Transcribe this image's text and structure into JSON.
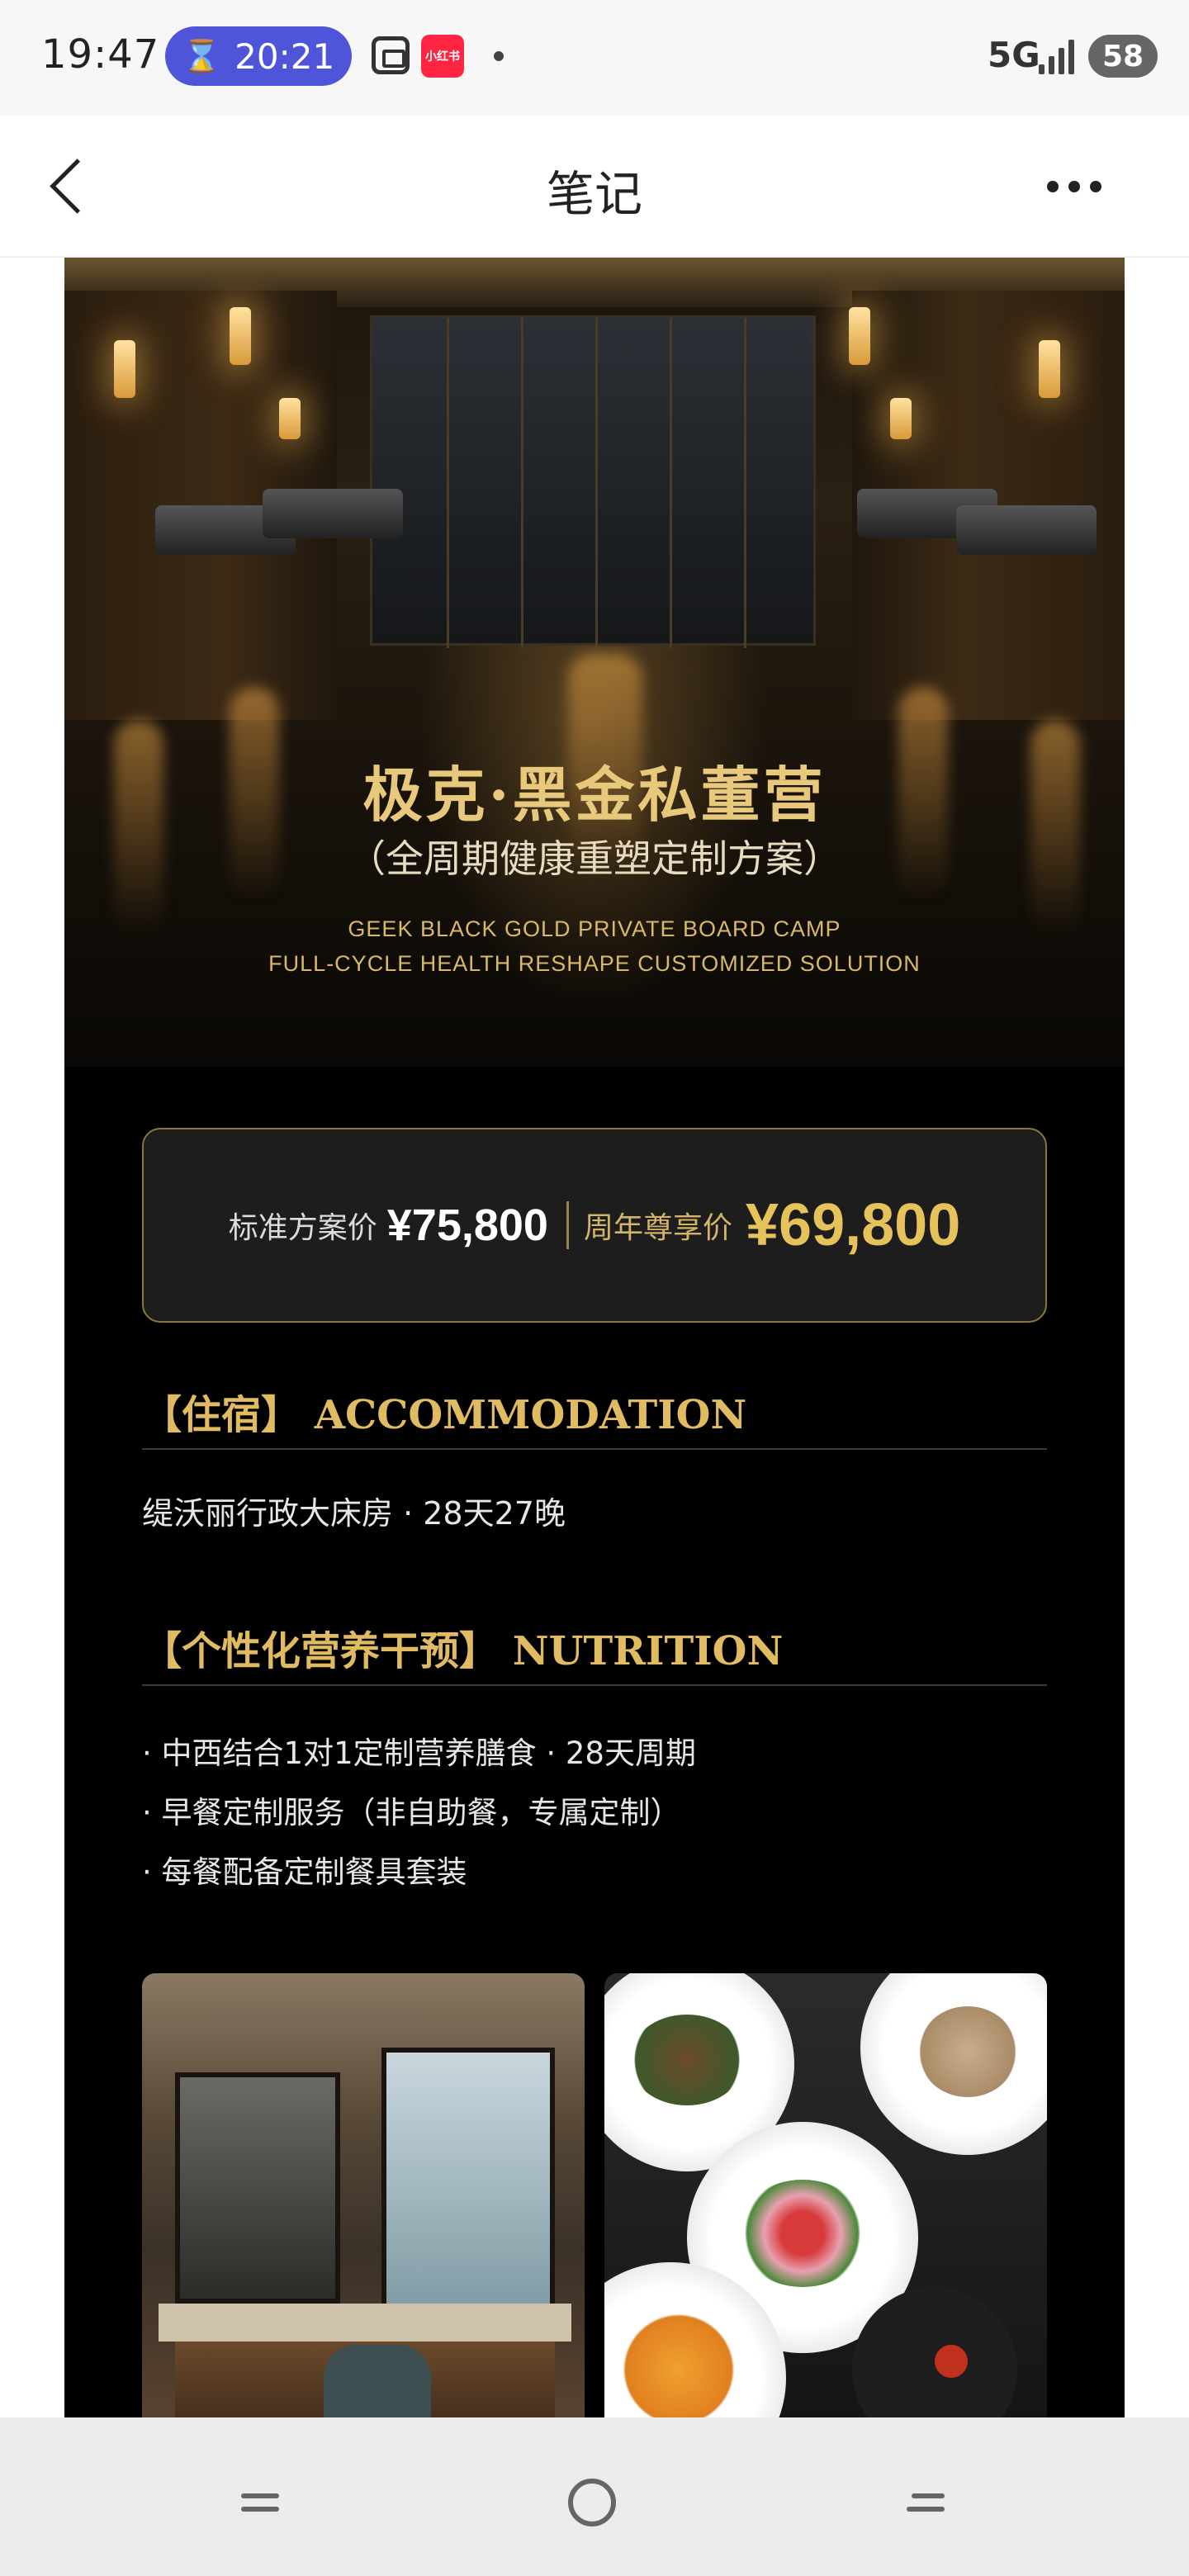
{
  "status_bar": {
    "time": "19:47",
    "timer": "20:21",
    "app_badge": "小红书",
    "network": "5G",
    "battery": "58"
  },
  "nav": {
    "title": "笔记"
  },
  "hero": {
    "title": "极克·黑金私董营",
    "subtitle": "（全周期健康重塑定制方案）",
    "en_line1": "GEEK BLACK GOLD PRIVATE BOARD CAMP",
    "en_line2": "FULL-CYCLE HEALTH RESHAPE CUSTOMIZED SOLUTION"
  },
  "price": {
    "standard_label": "标准方案价",
    "standard_value": "¥75,800",
    "anniversary_label": "周年尊享价",
    "anniversary_value": "¥69,800"
  },
  "sections": {
    "accommodation": {
      "title": "【住宿】 ACCOMMODATION",
      "text": "缇沃丽行政大床房 · 28天27晚"
    },
    "nutrition": {
      "title": "【个性化营养干预】 NUTRITION",
      "items": [
        "· 中西结合1对1定制营养膳食 · 28天周期",
        "· 早餐定制服务（非自助餐，专属定制）",
        "· 每餐配备定制餐具套装"
      ]
    }
  },
  "colors": {
    "accent_gold": "#e0bb62",
    "price_gold": "#e6c25a",
    "poster_bg": "#000000",
    "pill_blue": "#4f55d8",
    "brand_red": "#ff2442"
  },
  "icons": {
    "back": "chevron-left-icon",
    "more": "more-horizontal-icon",
    "timer": "hourglass-icon",
    "scan": "screenshot-icon"
  }
}
